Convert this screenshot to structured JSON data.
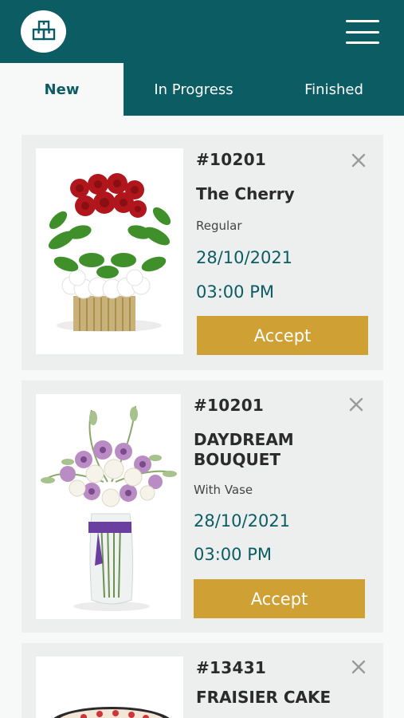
{
  "header": {
    "logo_icon": "boxes-icon",
    "menu_icon": "hamburger-menu-icon",
    "brand_color": "#0b5c63"
  },
  "tabs": [
    {
      "label": "New",
      "active": true
    },
    {
      "label": "In Progress",
      "active": false
    },
    {
      "label": "Finished",
      "active": false
    }
  ],
  "orders": [
    {
      "order_number": "#10201",
      "product_name": "The Cherry",
      "variant": "Regular",
      "date": "28/10/2021",
      "time": "03:00 PM",
      "accept_label": "Accept",
      "image": "red-roses-arrangement"
    },
    {
      "order_number": "#10201",
      "product_name": "DAYDREAM BOUQUET",
      "variant": "With Vase",
      "date": "28/10/2021",
      "time": "03:00 PM",
      "accept_label": "Accept",
      "image": "purple-white-bouquet-vase"
    },
    {
      "order_number": "#13431",
      "product_name": "FRAISIER CAKE",
      "image": "fraisier-cake"
    }
  ],
  "colors": {
    "accent": "#cfa034",
    "teal_text": "#0b5c63",
    "card_bg": "#edeeee"
  }
}
